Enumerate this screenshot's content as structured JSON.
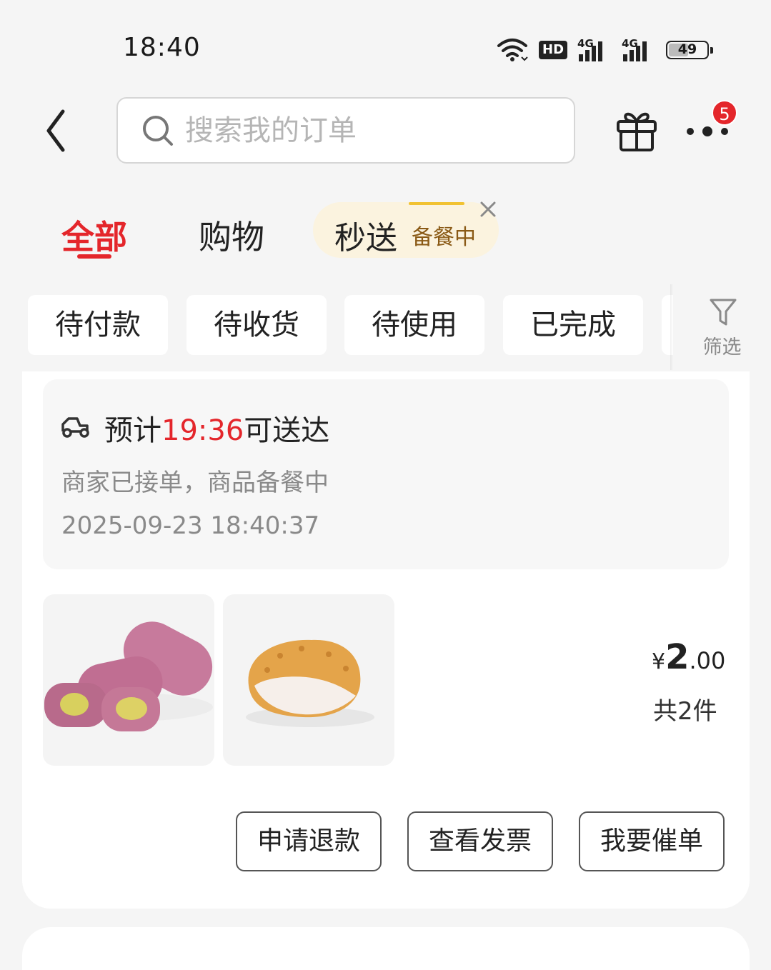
{
  "status_bar": {
    "time": "18:40",
    "hd_label": "HD",
    "signal_label_1": "4G",
    "signal_label_2": "4G",
    "battery": "49",
    "icons": [
      "wifi-icon",
      "hd-icon",
      "signal-icon",
      "signal-icon",
      "battery-icon"
    ]
  },
  "header": {
    "search_placeholder": "搜索我的订单",
    "more_badge_count": "5",
    "icons": [
      "back-icon",
      "search-icon",
      "gift-icon",
      "more-icon"
    ]
  },
  "tabs": {
    "all": "全部",
    "shopping": "购物",
    "flash": "秒送",
    "flash_status": "备餐中",
    "active": "全部"
  },
  "filters": {
    "chips": [
      "待付款",
      "待收货",
      "待使用",
      "已完成"
    ],
    "filter_label": "筛选"
  },
  "order": {
    "eta_prefix": "预计",
    "eta_time": "19:36",
    "eta_suffix": "可送达",
    "store_status": "商家已接单，商品备餐中",
    "order_time": "2025-09-23 18:40:37",
    "price_symbol": "¥",
    "price_int": "2",
    "price_dec": ".00",
    "item_count": "共2件",
    "products": [
      "purple-sweet-potato-mochi",
      "fried-chicken-fillet"
    ],
    "actions": {
      "refund": "申请退款",
      "invoice": "查看发票",
      "urge": "我要催单"
    }
  },
  "colors": {
    "accent": "#e4262b",
    "flash_bg": "#fbf3df",
    "flash_text": "#8a5a16"
  }
}
